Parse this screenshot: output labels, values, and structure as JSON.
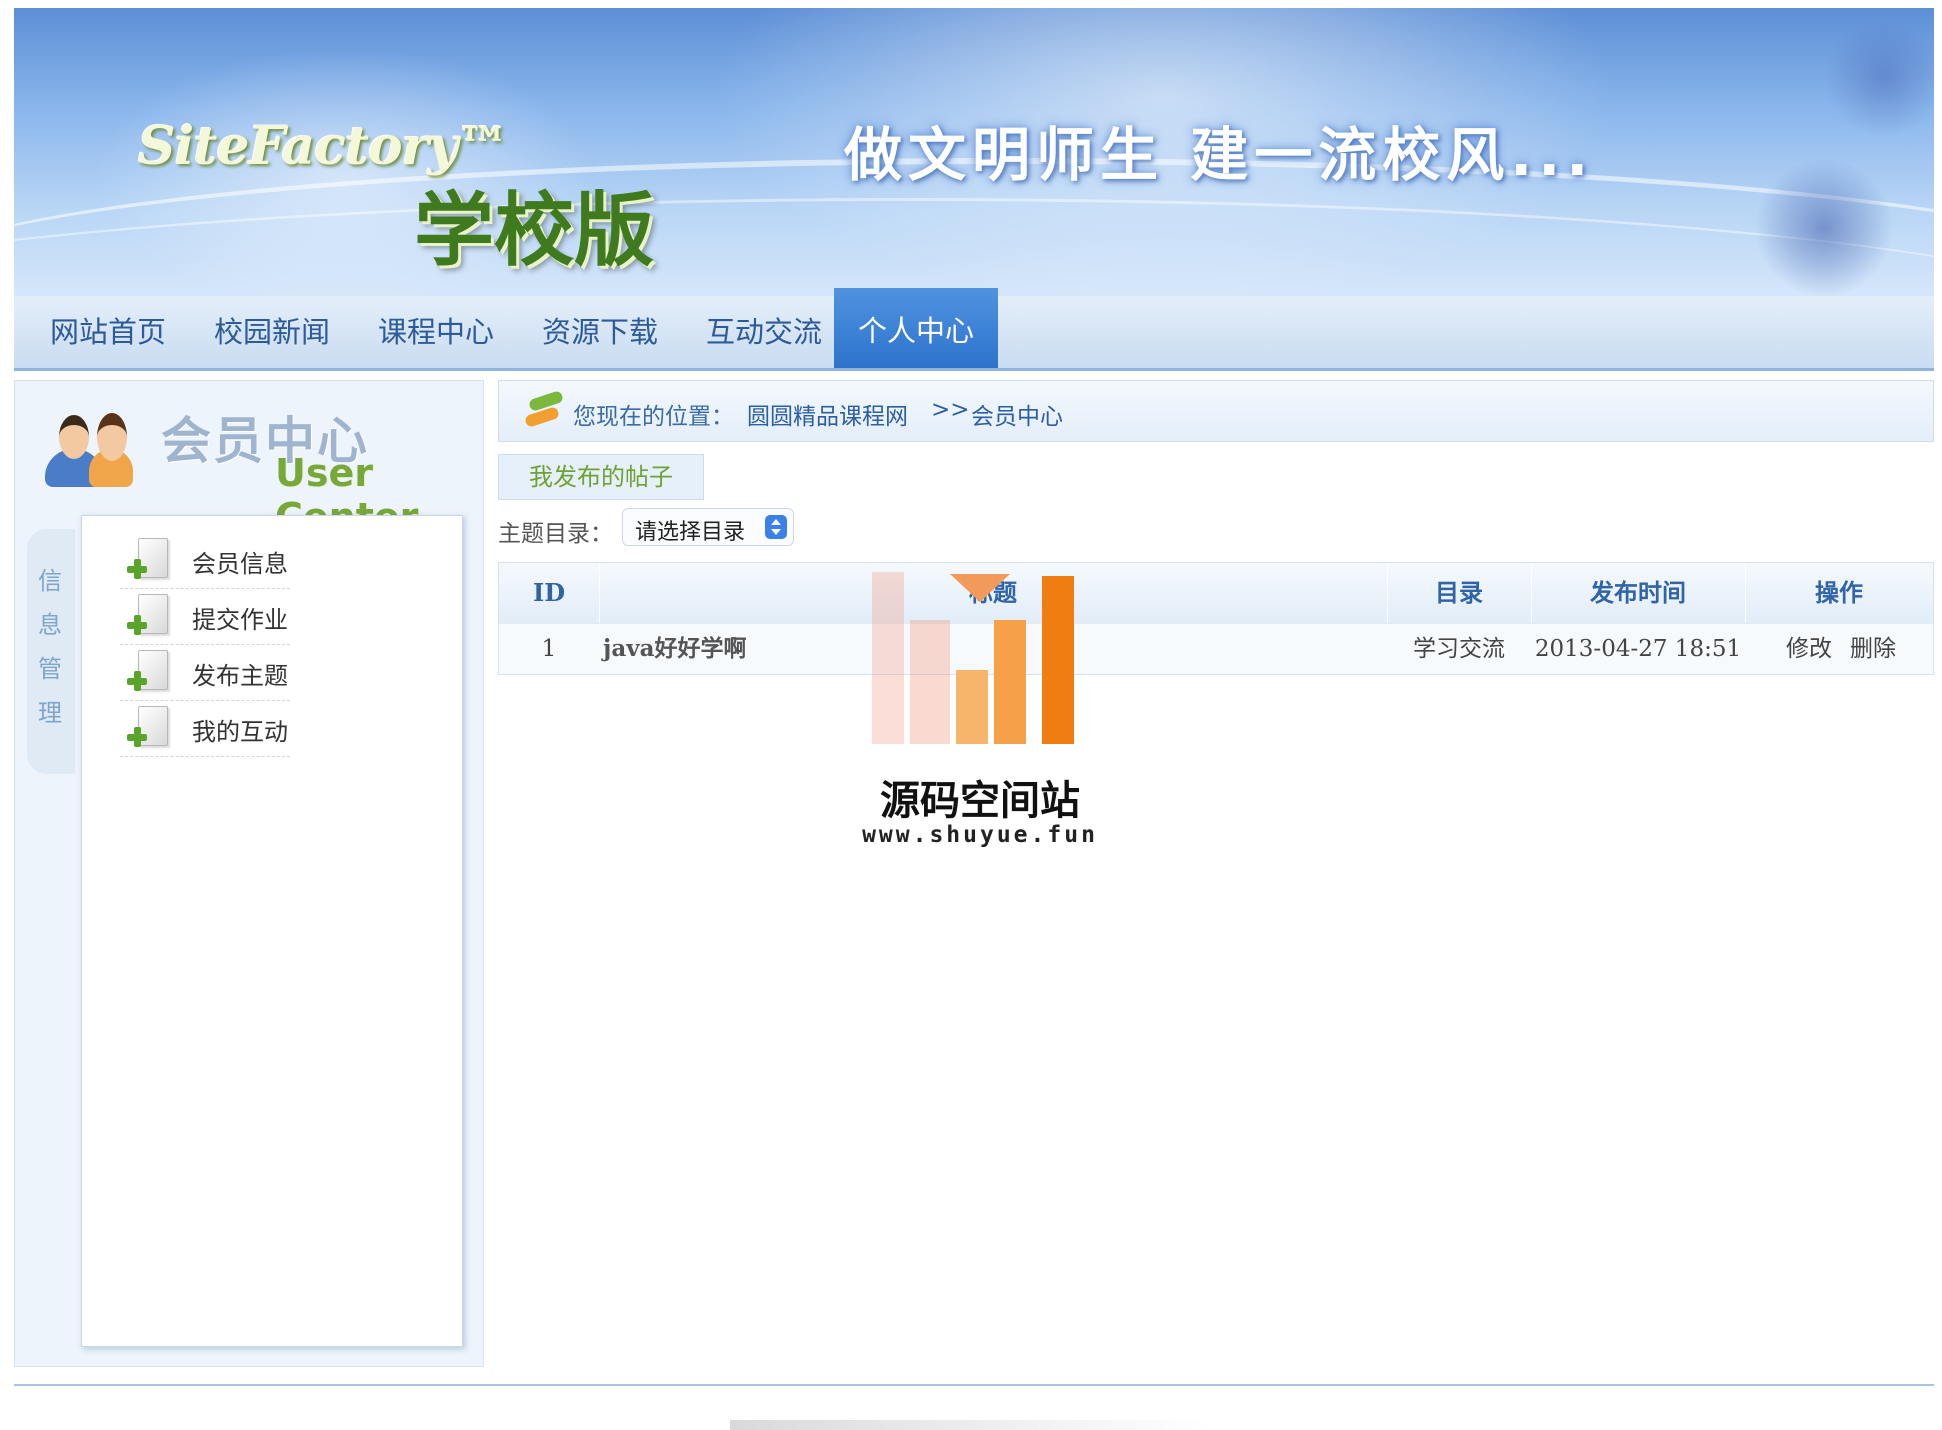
{
  "banner": {
    "logo_en": "SiteFactory™",
    "logo_cn": "学校版",
    "slogan": "做文明师生  建一流校风..."
  },
  "nav": {
    "items": [
      {
        "label": "网站首页"
      },
      {
        "label": "校园新闻"
      },
      {
        "label": "课程中心"
      },
      {
        "label": "资源下载"
      },
      {
        "label": "互动交流"
      },
      {
        "label": "个人中心",
        "active": true
      }
    ]
  },
  "sidebar": {
    "title_cn": "会员中心",
    "title_en": "User Center",
    "tab_label": "信息管理",
    "menu": [
      {
        "label": "会员信息",
        "icon": "document-add-icon"
      },
      {
        "label": "提交作业",
        "icon": "document-add-icon"
      },
      {
        "label": "发布主题",
        "icon": "document-add-icon"
      },
      {
        "label": "我的互动",
        "icon": "document-add-icon"
      }
    ]
  },
  "breadcrumb": {
    "prefix": "您现在的位置：",
    "site": "圆圆精品课程网",
    "separator": ">>",
    "current": "会员中心"
  },
  "main": {
    "tab_label": "我发布的帖子",
    "filter_label": "主题目录：",
    "filter_select_value": "请选择目录",
    "table": {
      "headers": [
        "ID",
        "标题",
        "目录",
        "发布时间",
        "操作"
      ],
      "rows": [
        {
          "id": "1",
          "title": "java好好学啊",
          "category": "学习交流",
          "time": "2013-04-27 18:51",
          "edit": "修改",
          "delete": "删除"
        }
      ]
    }
  },
  "watermark": {
    "name": "源码空间站",
    "url": "www.shuyue.fun"
  },
  "colors": {
    "nav_active": "#3a80d6",
    "link": "#2b5ea5",
    "accent_green": "#6fa232",
    "watermark_orange": "#f07d12"
  }
}
